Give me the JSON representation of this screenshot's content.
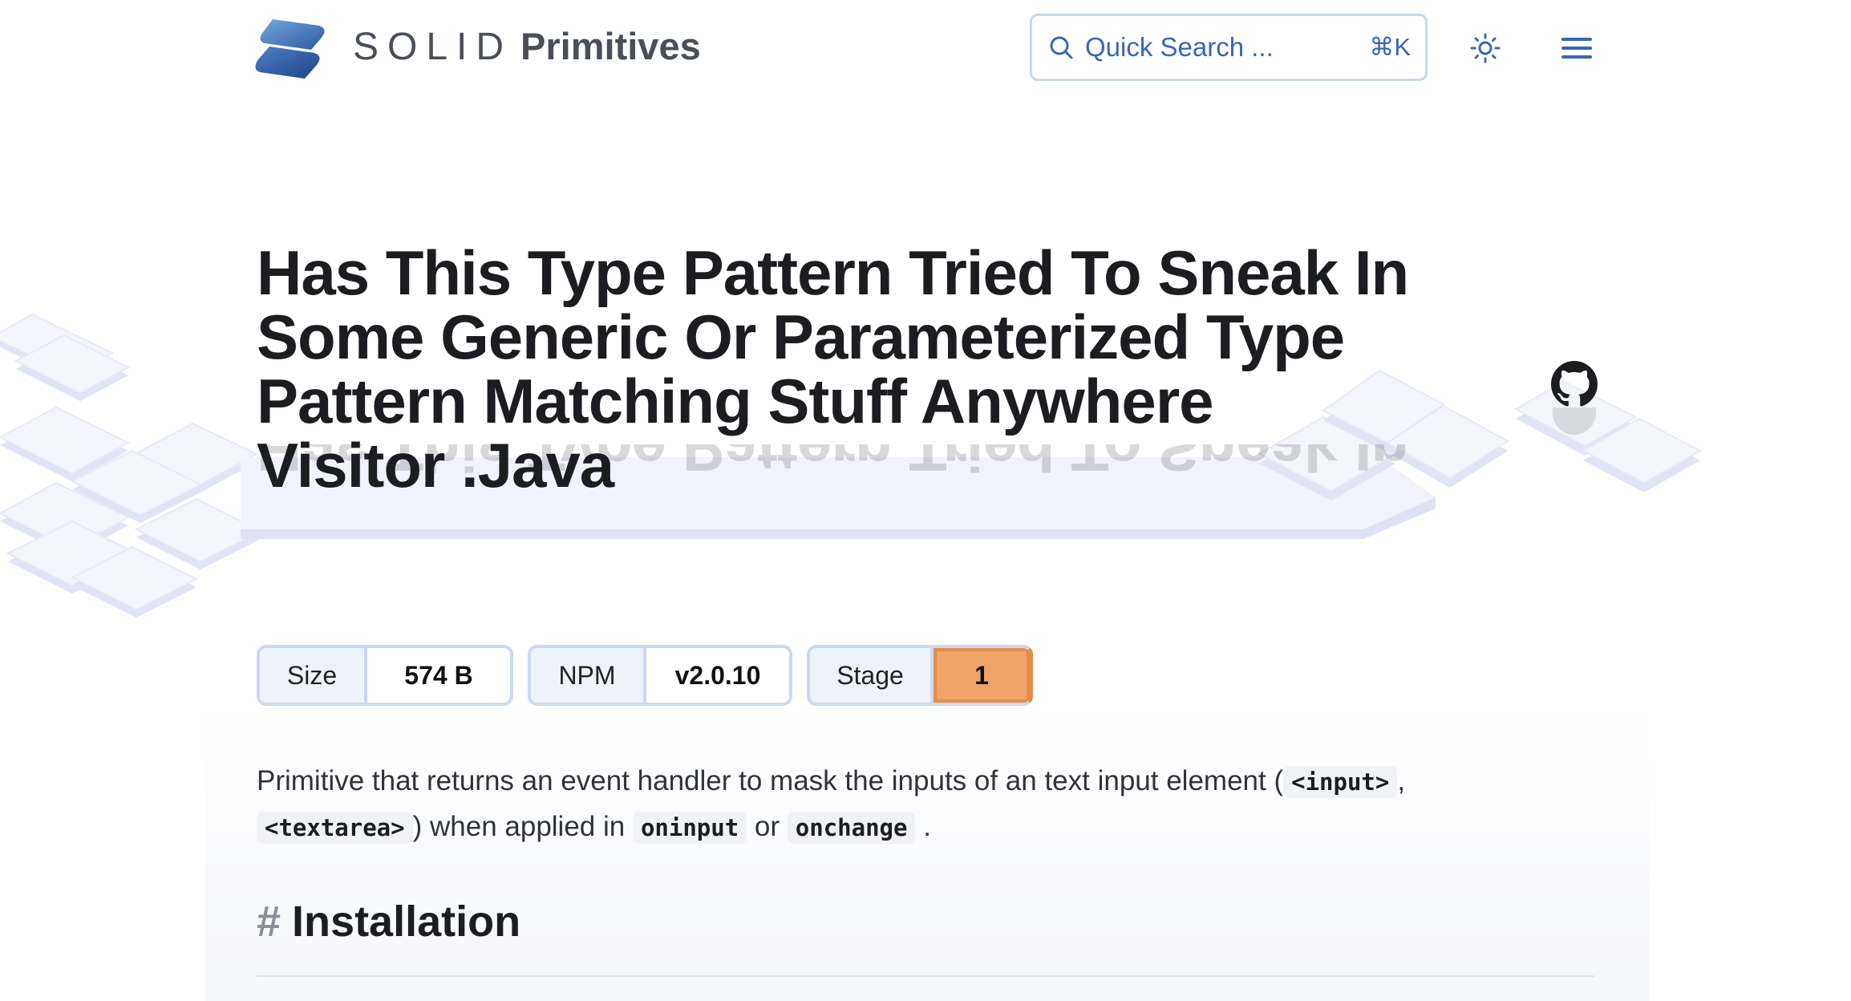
{
  "header": {
    "brand_solid": "SOLID",
    "brand_primitives": "Primitives",
    "search": {
      "placeholder": "Quick Search ...",
      "shortcut": "⌘K"
    },
    "icons": {
      "logo": "solid-logo",
      "search": "search-icon",
      "theme": "sun-icon",
      "menu": "hamburger-menu-icon"
    }
  },
  "page": {
    "title": "Has This Type Pattern Tried To Sneak In Some Generic Or Parameterized Type Pattern Matching Stuff Anywhere Visitor .Java",
    "github_icon": "github-icon",
    "badges": [
      {
        "label": "Size",
        "value": "574 B"
      },
      {
        "label": "NPM",
        "value": "v2.0.10"
      },
      {
        "label": "Stage",
        "value": "1"
      }
    ],
    "description": {
      "part1": "Primitive that returns an event handler to mask the inputs of an text input element (",
      "code1": "<input>",
      "part2": ",",
      "code2": "<textarea>",
      "part3": ") when applied in",
      "code3": "oninput",
      "part4": "or",
      "code4": "onchange",
      "part5": "."
    },
    "section": {
      "hash": "#",
      "heading": "Installation"
    }
  },
  "colors": {
    "accent": "#3a66b7",
    "stage_badge": "#f0a46a",
    "stage_border": "#e68b47",
    "badge_border": "#cdd8f0"
  }
}
